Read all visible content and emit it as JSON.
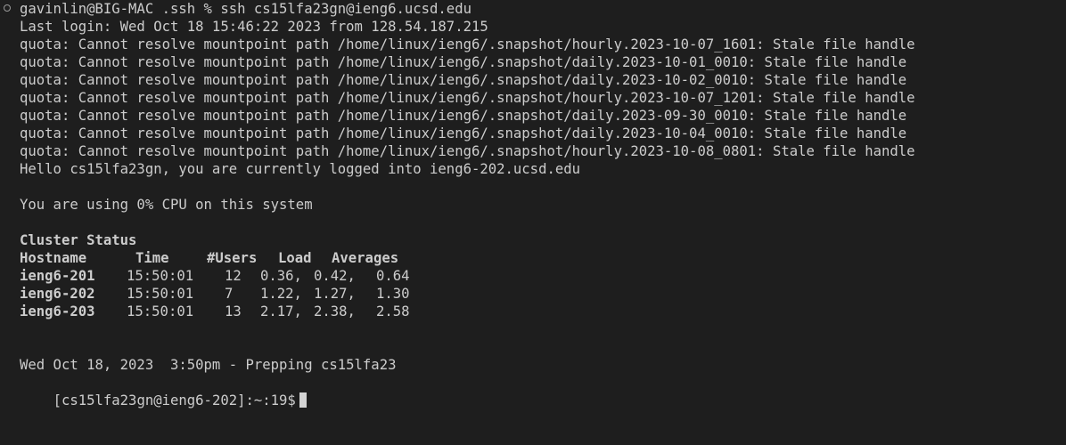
{
  "session": {
    "local_prompt": "gavinlin@BIG-MAC .ssh % ssh cs15lfa23gn@ieng6.ucsd.edu",
    "last_login": "Last login: Wed Oct 18 15:46:22 2023 from 128.54.187.215"
  },
  "quota_warnings": [
    "quota: Cannot resolve mountpoint path /home/linux/ieng6/.snapshot/hourly.2023-10-07_1601: Stale file handle",
    "quota: Cannot resolve mountpoint path /home/linux/ieng6/.snapshot/daily.2023-10-01_0010: Stale file handle",
    "quota: Cannot resolve mountpoint path /home/linux/ieng6/.snapshot/daily.2023-10-02_0010: Stale file handle",
    "quota: Cannot resolve mountpoint path /home/linux/ieng6/.snapshot/hourly.2023-10-07_1201: Stale file handle",
    "quota: Cannot resolve mountpoint path /home/linux/ieng6/.snapshot/daily.2023-09-30_0010: Stale file handle",
    "quota: Cannot resolve mountpoint path /home/linux/ieng6/.snapshot/daily.2023-10-04_0010: Stale file handle",
    "quota: Cannot resolve mountpoint path /home/linux/ieng6/.snapshot/hourly.2023-10-08_0801: Stale file handle"
  ],
  "greeting": "Hello cs15lfa23gn, you are currently logged into ieng6-202.ucsd.edu",
  "cpu_usage": "You are using 0% CPU on this system",
  "cluster": {
    "title": "Cluster Status",
    "headers": [
      "Hostname",
      "Time",
      "#Users",
      "Load",
      "Averages"
    ],
    "rows": [
      {
        "host": "ieng6-201",
        "time": "15:50:01",
        "users": "12",
        "load1": "0.36,",
        "load5": "0.42,",
        "load15": "0.64"
      },
      {
        "host": "ieng6-202",
        "time": "15:50:01",
        "users": "7",
        "load1": "1.22,",
        "load5": "1.27,",
        "load15": "1.30"
      },
      {
        "host": "ieng6-203",
        "time": "15:50:01",
        "users": "13",
        "load1": "2.17,",
        "load5": "2.38,",
        "load15": "2.58"
      }
    ]
  },
  "motd": "Wed Oct 18, 2023  3:50pm - Prepping cs15lfa23",
  "remote_prompt": "[cs15lfa23gn@ieng6-202]:~:19$"
}
